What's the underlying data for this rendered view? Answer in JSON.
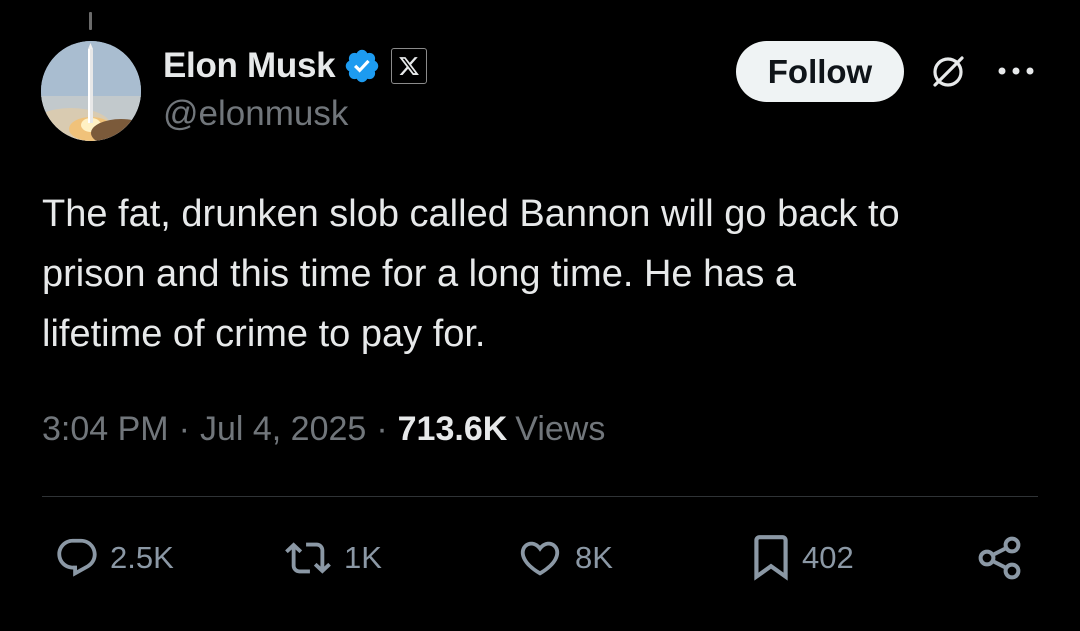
{
  "author": {
    "display_name": "Elon Musk",
    "handle": "@elonmusk",
    "verified": true,
    "affiliate_badge_icon": "x-logo-icon"
  },
  "header": {
    "follow_label": "Follow",
    "grok_icon": "grok-icon",
    "more_icon": "more-icon"
  },
  "tweet": {
    "lines": [
      "The fat, drunken slob called Bannon will go back to",
      "prison and this time for a long time. He has a",
      "lifetime of crime to pay for."
    ]
  },
  "meta": {
    "time": "3:04 PM",
    "separator": "·",
    "date": "Jul 4, 2025",
    "views_count": "713.6K",
    "views_label": "Views"
  },
  "actions": {
    "reply": "2.5K",
    "repost": "1K",
    "like": "8K",
    "bookmark": "402",
    "share_icon": "share-icon"
  },
  "colors": {
    "background": "#000000",
    "primary_text": "#e7e9ea",
    "secondary_text": "#71767b",
    "verified_blue": "#1d9bf0",
    "follow_bg": "#eff3f4",
    "divider": "#2f3336"
  }
}
